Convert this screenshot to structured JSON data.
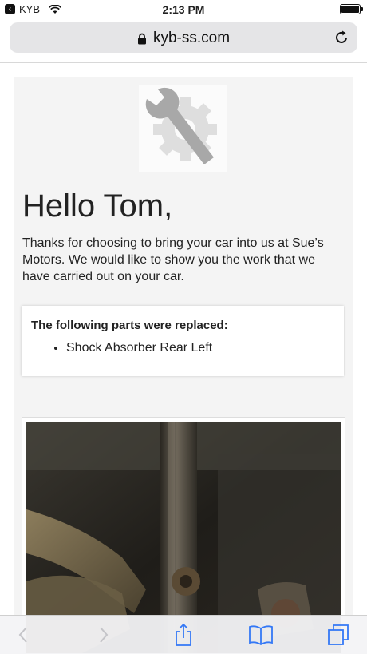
{
  "status_bar": {
    "carrier": "KYB",
    "time": "2:13 PM"
  },
  "browser": {
    "url": "kyb-ss.com"
  },
  "email": {
    "greeting": "Hello Tom,",
    "intro": "Thanks for choosing to bring your car into us at Sue’s Motors. We would like to show you the work that we have carried out on your car.",
    "parts_heading": "The following parts were replaced:",
    "parts": [
      "Shock Absorber Rear Left"
    ]
  },
  "colors": {
    "ios_blue": "#3478f6",
    "logo_gray": "#a8a8a8"
  }
}
